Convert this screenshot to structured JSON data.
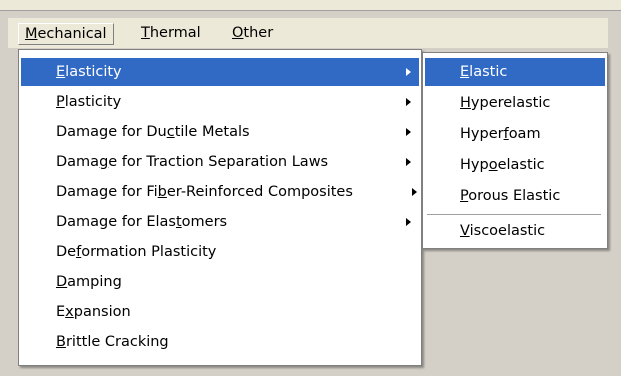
{
  "menubar": {
    "items": [
      {
        "pre": "",
        "u": "M",
        "post": "echanical"
      },
      {
        "pre": "",
        "u": "T",
        "post": "hermal"
      },
      {
        "pre": "",
        "u": "O",
        "post": "ther"
      }
    ]
  },
  "main_menu": {
    "items": [
      {
        "pre": "",
        "u": "E",
        "post": "lasticity"
      },
      {
        "pre": "",
        "u": "P",
        "post": "lasticity"
      },
      {
        "pre": "Damage for Du",
        "u": "c",
        "post": "tile Metals"
      },
      {
        "pre": "Dama",
        "u": "g",
        "post": "e for Traction Separation Laws"
      },
      {
        "pre": "Damage for Fi",
        "u": "b",
        "post": "er-Reinforced Composites"
      },
      {
        "pre": "Damage for Elas",
        "u": "t",
        "post": "omers"
      },
      {
        "pre": "De",
        "u": "f",
        "post": "ormation Plasticity"
      },
      {
        "pre": "",
        "u": "D",
        "post": "amping"
      },
      {
        "pre": "E",
        "u": "x",
        "post": "pansion"
      },
      {
        "pre": "",
        "u": "B",
        "post": "rittle Cracking"
      }
    ]
  },
  "submenu": {
    "items": [
      {
        "pre": "",
        "u": "E",
        "post": "lastic"
      },
      {
        "pre": "",
        "u": "H",
        "post": "yperelastic"
      },
      {
        "pre": "Hyper",
        "u": "f",
        "post": "oam"
      },
      {
        "pre": "Hyp",
        "u": "o",
        "post": "elastic"
      },
      {
        "pre": "",
        "u": "P",
        "post": "orous Elastic"
      },
      {
        "pre": "",
        "u": "V",
        "post": "iscoelastic"
      }
    ]
  },
  "colors": {
    "highlight": "#316ac5",
    "menu_bg": "#ffffff",
    "bar_bg": "#ece9d8"
  }
}
